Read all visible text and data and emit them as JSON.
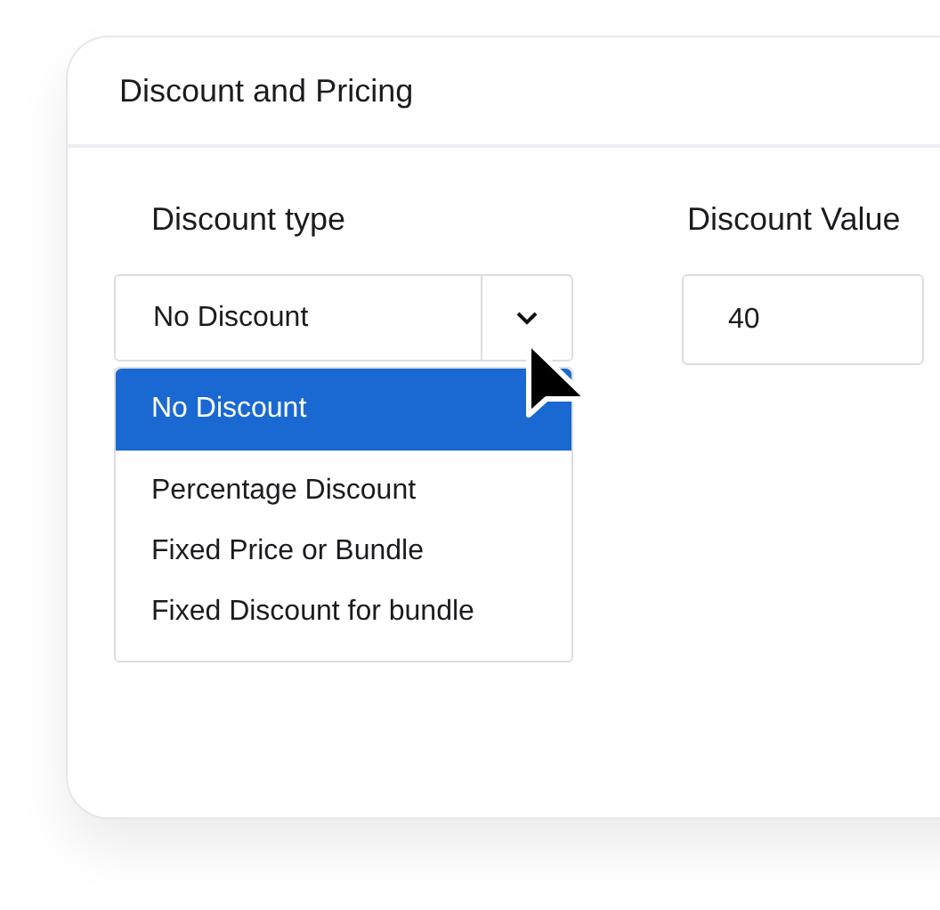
{
  "card": {
    "title": "Discount and Pricing"
  },
  "discount_type": {
    "label": "Discount type",
    "value": "No Discount",
    "expanded": true,
    "options": [
      {
        "label": "No Discount",
        "selected": true
      },
      {
        "label": "Percentage Discount",
        "selected": false
      },
      {
        "label": "Fixed Price or Bundle",
        "selected": false
      },
      {
        "label": "Fixed Discount for bundle",
        "selected": false
      }
    ]
  },
  "discount_value": {
    "label": "Discount Value",
    "value": "40"
  }
}
